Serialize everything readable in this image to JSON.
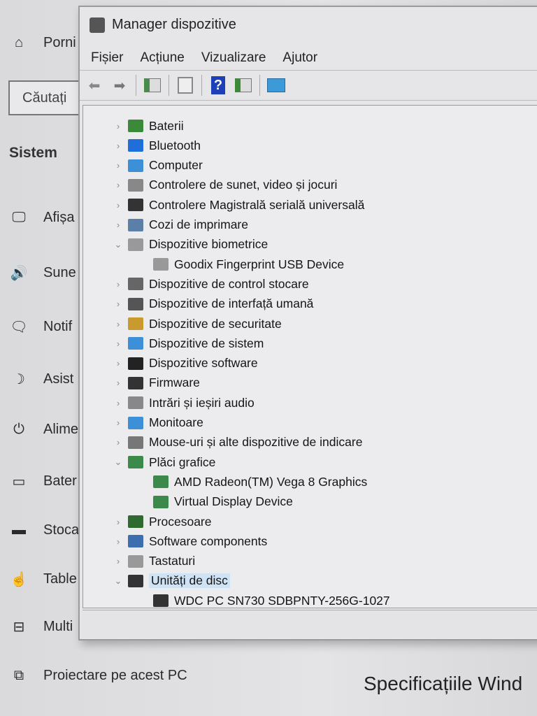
{
  "settings": {
    "home": "Porni",
    "search_placeholder": "Căutați",
    "section": "Sistem",
    "items": [
      {
        "icon": "monitor-icon",
        "glyph": "🖵",
        "label": "Afișa"
      },
      {
        "icon": "speaker-icon",
        "glyph": "🔊",
        "label": "Sune"
      },
      {
        "icon": "notification-icon",
        "glyph": "🗨",
        "label": "Notif"
      },
      {
        "icon": "moon-icon",
        "glyph": "☽",
        "label": "Asist"
      },
      {
        "icon": "power-icon",
        "glyph": "⏻",
        "label": "Alime"
      },
      {
        "icon": "battery-icon",
        "glyph": "▭",
        "label": "Bater"
      },
      {
        "icon": "storage-icon",
        "glyph": "▬",
        "label": "Stoca"
      },
      {
        "icon": "tablet-icon",
        "glyph": "☝",
        "label": "Table"
      },
      {
        "icon": "multitasking-icon",
        "glyph": "⊟",
        "label": "Multi"
      },
      {
        "icon": "project-icon",
        "glyph": "⧉",
        "label": "Proiectare pe acest PC"
      }
    ],
    "right_heading": "Specificațiile Wind"
  },
  "window": {
    "title": "Manager dispozitive",
    "menu": [
      "Fișier",
      "Acțiune",
      "Vizualizare",
      "Ajutor"
    ],
    "tree": [
      {
        "label": "Baterii",
        "level": 0,
        "state": "collapsed",
        "color": "#3a8a3a"
      },
      {
        "label": "Bluetooth",
        "level": 0,
        "state": "collapsed",
        "color": "#1e6fd9"
      },
      {
        "label": "Computer",
        "level": 0,
        "state": "collapsed",
        "color": "#3d8fd8"
      },
      {
        "label": "Controlere de sunet, video și jocuri",
        "level": 0,
        "state": "collapsed",
        "color": "#888888"
      },
      {
        "label": "Controlere Magistrală serială universală",
        "level": 0,
        "state": "collapsed",
        "color": "#333333"
      },
      {
        "label": "Cozi de imprimare",
        "level": 0,
        "state": "collapsed",
        "color": "#5a7fa8"
      },
      {
        "label": "Dispozitive biometrice",
        "level": 0,
        "state": "expanded",
        "color": "#999999"
      },
      {
        "label": "Goodix Fingerprint USB Device",
        "level": 1,
        "state": "none",
        "color": "#999999"
      },
      {
        "label": "Dispozitive de control stocare",
        "level": 0,
        "state": "collapsed",
        "color": "#666666"
      },
      {
        "label": "Dispozitive de interfață umană",
        "level": 0,
        "state": "collapsed",
        "color": "#555555"
      },
      {
        "label": "Dispozitive de securitate",
        "level": 0,
        "state": "collapsed",
        "color": "#c99a2e"
      },
      {
        "label": "Dispozitive de sistem",
        "level": 0,
        "state": "collapsed",
        "color": "#3d8fd8"
      },
      {
        "label": "Dispozitive software",
        "level": 0,
        "state": "collapsed",
        "color": "#222222"
      },
      {
        "label": "Firmware",
        "level": 0,
        "state": "collapsed",
        "color": "#333333"
      },
      {
        "label": "Intrări și ieșiri audio",
        "level": 0,
        "state": "collapsed",
        "color": "#888888"
      },
      {
        "label": "Monitoare",
        "level": 0,
        "state": "collapsed",
        "color": "#3d8fd8"
      },
      {
        "label": "Mouse-uri și alte dispozitive de indicare",
        "level": 0,
        "state": "collapsed",
        "color": "#777777"
      },
      {
        "label": "Plăci grafice",
        "level": 0,
        "state": "expanded",
        "color": "#3b8a4a"
      },
      {
        "label": "AMD Radeon(TM) Vega 8 Graphics",
        "level": 1,
        "state": "none",
        "color": "#3b8a4a"
      },
      {
        "label": "Virtual Display Device",
        "level": 1,
        "state": "none",
        "color": "#3b8a4a"
      },
      {
        "label": "Procesoare",
        "level": 0,
        "state": "collapsed",
        "color": "#2f6b2f"
      },
      {
        "label": "Software components",
        "level": 0,
        "state": "collapsed",
        "color": "#3d6fb0"
      },
      {
        "label": "Tastaturi",
        "level": 0,
        "state": "collapsed",
        "color": "#999999"
      },
      {
        "label": "Unități de disc",
        "level": 0,
        "state": "expanded",
        "selected": true,
        "color": "#333333"
      },
      {
        "label": "WDC PC SN730 SDBPNTY-256G-1027",
        "level": 1,
        "state": "none",
        "color": "#333333"
      }
    ]
  }
}
